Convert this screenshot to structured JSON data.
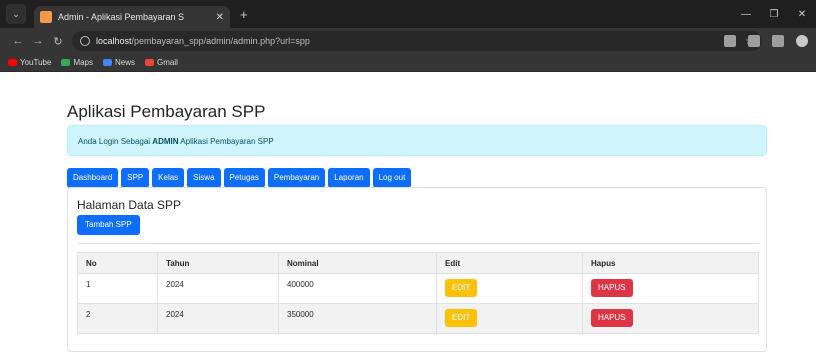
{
  "browser": {
    "tab_title": "Admin - Aplikasi Pembayaran S",
    "url_host": "localhost",
    "url_path": "/pembayaran_spp/admin/admin.php?url=spp",
    "bookmarks": [
      "YouTube",
      "Maps",
      "News",
      "Gmail"
    ]
  },
  "app": {
    "title": "Aplikasi Pembayaran SPP",
    "alert_prefix": "Anda Login Sebagai",
    "alert_role": "ADMIN",
    "alert_suffix": "Aplikasi Pembayaran SPP"
  },
  "nav": {
    "items": [
      "Dashboard",
      "SPP",
      "Kelas",
      "Siswa",
      "Petugas",
      "Pembayaran",
      "Laporan",
      "Log out"
    ]
  },
  "card": {
    "title": "Halaman Data SPP",
    "add_button": "Tambah SPP"
  },
  "table": {
    "headers": [
      "No",
      "Tahun",
      "Nominal",
      "Edit",
      "Hapus"
    ],
    "rows": [
      {
        "no": "1",
        "tahun": "2024",
        "nominal": "400000",
        "edit": "EDIT",
        "hapus": "HAPUS"
      },
      {
        "no": "2",
        "tahun": "2024",
        "nominal": "350000",
        "edit": "EDIT",
        "hapus": "HAPUS"
      }
    ]
  },
  "colors": {
    "primary": "#0d6efd",
    "warning": "#ffc107",
    "danger": "#dc3545",
    "info_bg": "#cff4fc"
  }
}
